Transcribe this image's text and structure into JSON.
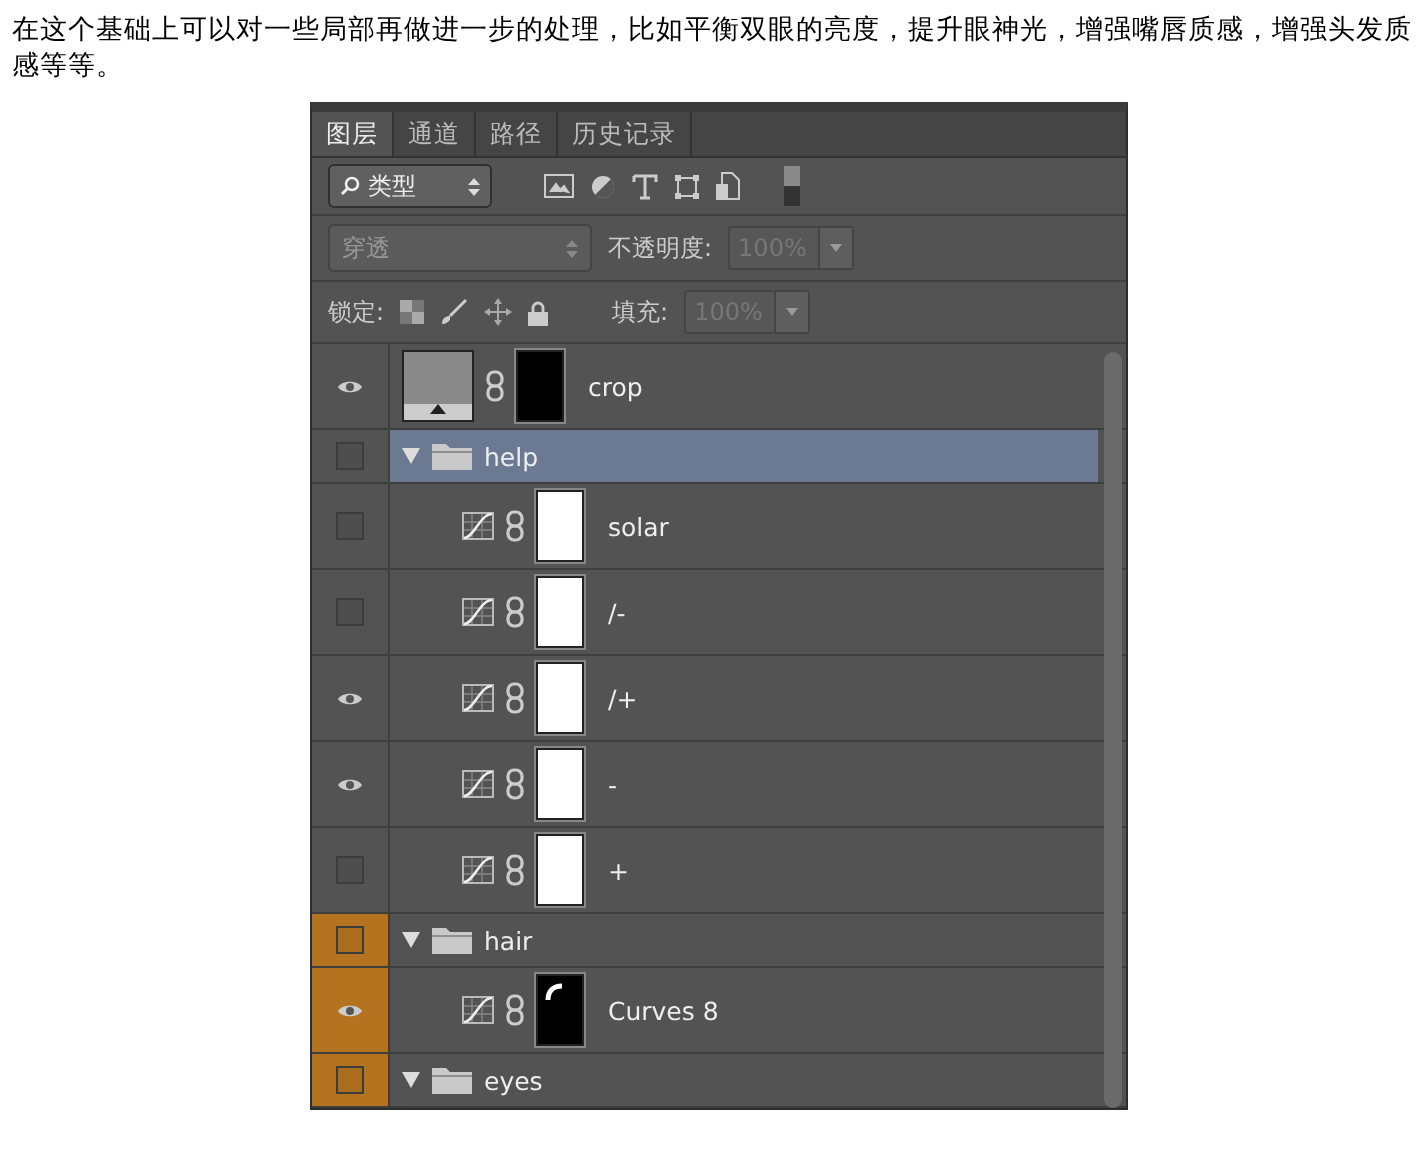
{
  "paragraph": "在这个基础上可以对一些局部再做进一步的处理，比如平衡双眼的亮度，提升眼神光，增强嘴唇质感，增强头发质感等等。",
  "panel": {
    "tabs": [
      {
        "label": "图层",
        "selected": true
      },
      {
        "label": "通道",
        "selected": false
      },
      {
        "label": "路径",
        "selected": false
      },
      {
        "label": "历史记录",
        "selected": false
      }
    ],
    "filter": {
      "value": "类型"
    },
    "blend": {
      "value": "穿透",
      "opacity_label": "不透明度:",
      "opacity": "100%",
      "opacity_disabled": true
    },
    "lock": {
      "label": "锁定:",
      "fill_label": "填充:",
      "fill": "100%",
      "fill_disabled": true
    },
    "layers": [
      {
        "kind": "fill",
        "name": "crop",
        "visible": true,
        "selected": false,
        "mask_black": true
      },
      {
        "kind": "group",
        "name": "help",
        "visible": false,
        "selected": true,
        "expanded": true,
        "children": [
          {
            "kind": "curves",
            "name": "solar",
            "visible": false,
            "selected": false,
            "mask_black": false
          },
          {
            "kind": "curves",
            "name": "/-",
            "visible": false,
            "selected": false,
            "mask_black": false
          },
          {
            "kind": "curves",
            "name": "/+",
            "visible": true,
            "selected": false,
            "mask_black": false
          },
          {
            "kind": "curves",
            "name": "-",
            "visible": true,
            "selected": false,
            "mask_black": false
          },
          {
            "kind": "curves",
            "name": "+",
            "visible": false,
            "selected": false,
            "mask_black": false
          }
        ]
      },
      {
        "kind": "group",
        "name": "hair",
        "visible": false,
        "selected": false,
        "expanded": true,
        "color": "#b5731f",
        "children": [
          {
            "kind": "curves",
            "name": "Curves 8",
            "visible": true,
            "selected": false,
            "mask_black": true,
            "color": "#b5731f"
          }
        ]
      },
      {
        "kind": "group",
        "name": "eyes",
        "visible": false,
        "selected": false,
        "expanded": true,
        "color": "#b5731f"
      }
    ]
  }
}
